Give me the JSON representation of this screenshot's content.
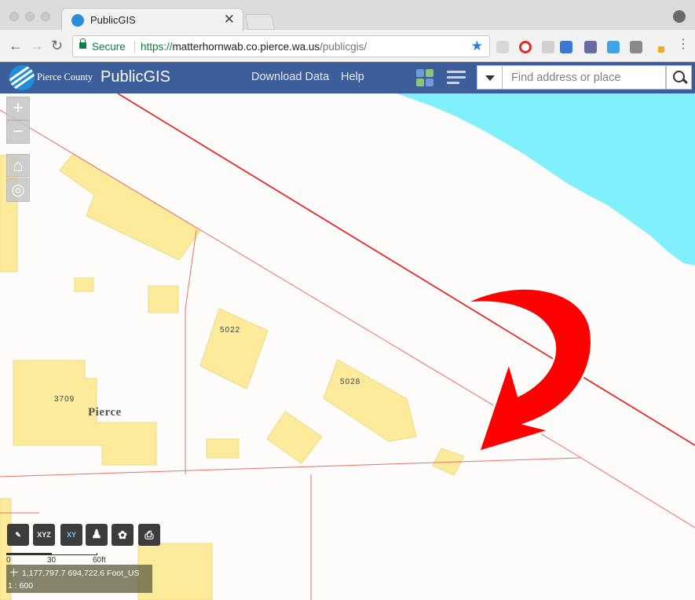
{
  "browser": {
    "tab_title": "PublicGIS",
    "tab_close": "✕",
    "secure_label": "Secure",
    "url_scheme": "https://",
    "url_host": "matterhornwab.co.pierce.wa.us",
    "url_path": "/publicgis/",
    "back": "←",
    "forward": "→",
    "reload": "↻",
    "star": "★"
  },
  "app": {
    "county": "Pierce County",
    "name": "PublicGIS",
    "nav": [
      "Download Data",
      "Help"
    ],
    "search_placeholder": "Find address or place"
  },
  "map": {
    "zoom_in": "+",
    "zoom_out": "−",
    "home": "⌂",
    "locate": "◎",
    "parcel_labels": [
      "5022",
      "5028",
      "3709"
    ],
    "place_name": "Pierce",
    "tools": [
      "measure-tool",
      "XYZ",
      "XY",
      "street-view-tool",
      "layer-style-tool",
      "print-tool"
    ],
    "scale_ticks": [
      "0",
      "30",
      "60ft"
    ],
    "coordinates": "1,177,797.7 694,722.6 Foot_US",
    "scale": "1 : 600"
  },
  "colors": {
    "app_header": "#3c5e9b",
    "water": "#80f0fc",
    "building": "#fbeb9a",
    "parcel_line": "#e8706e",
    "annotation_arrow": "#ff0000"
  }
}
